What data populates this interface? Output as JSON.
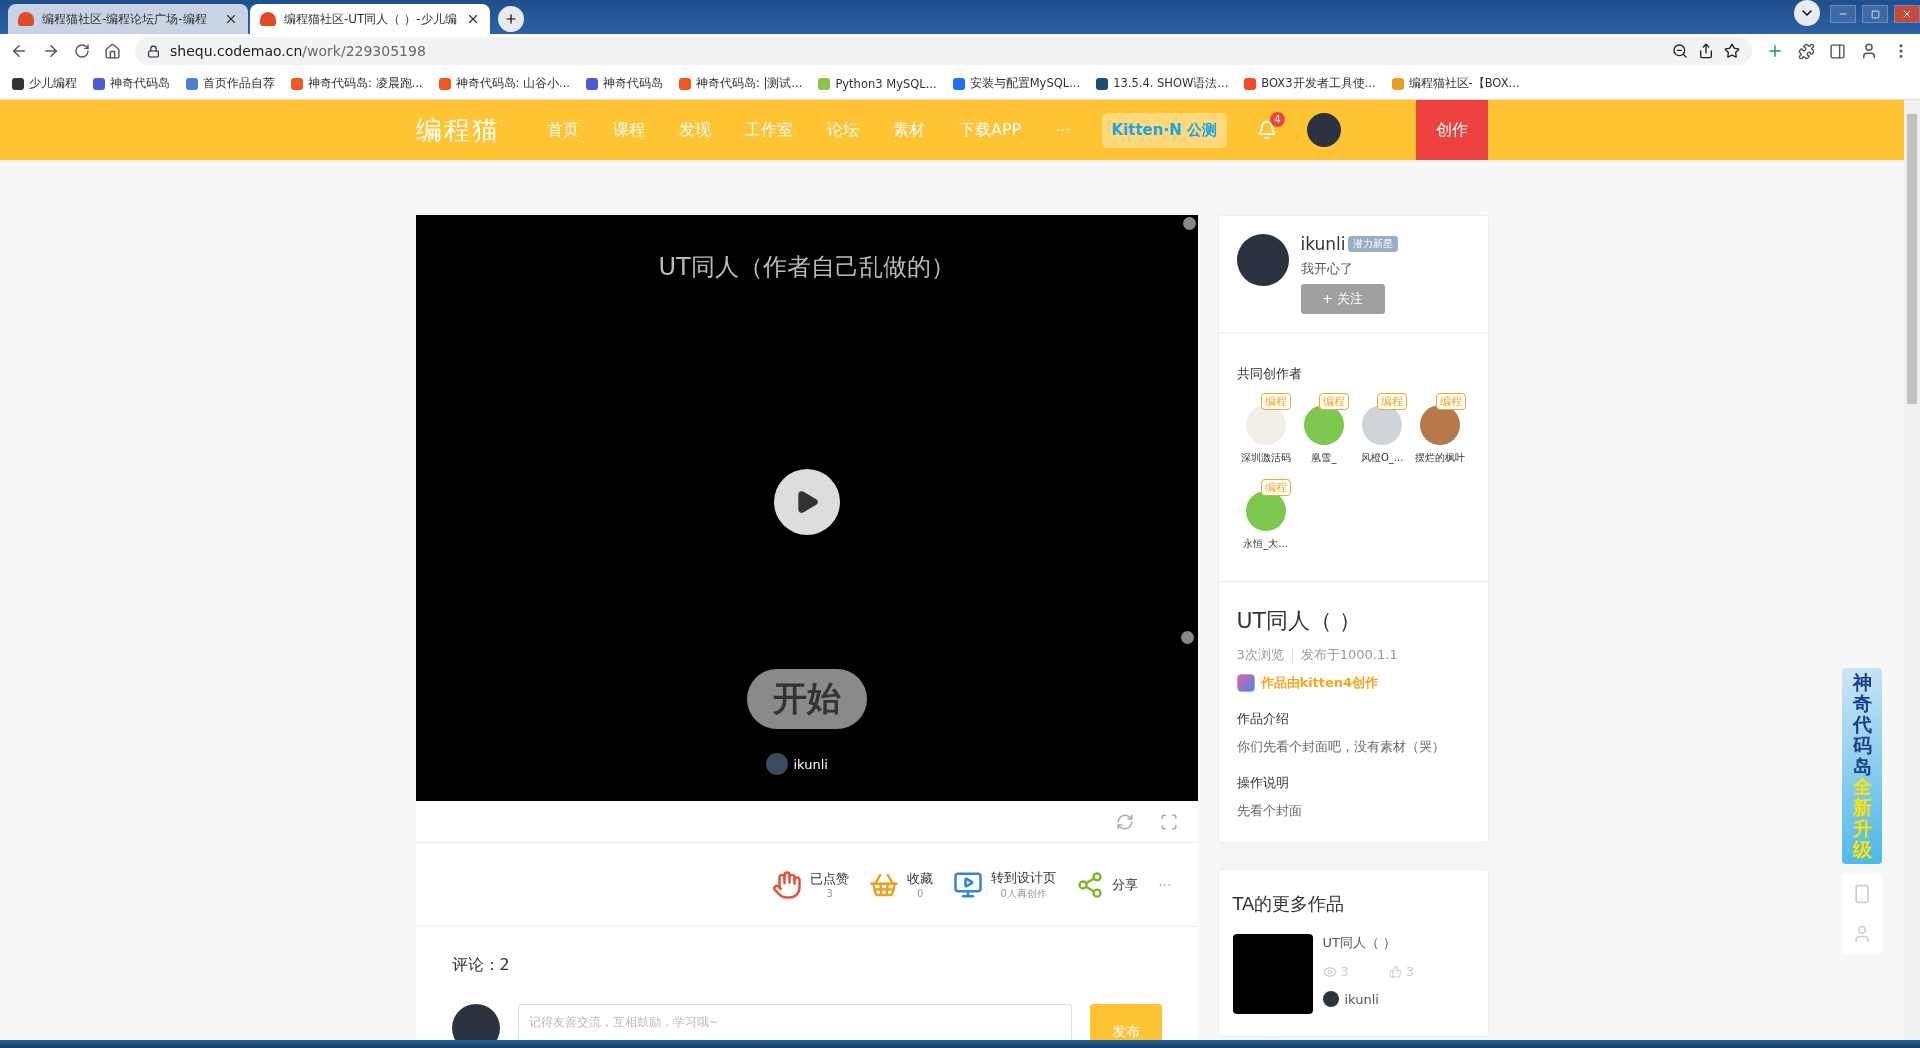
{
  "browser": {
    "tabs": [
      {
        "title": "编程猫社区-编程论坛广场-编程",
        "selected": false
      },
      {
        "title": "编程猫社区-UT同人（ ）-少儿编",
        "selected": true
      }
    ],
    "url_host": "shequ.codemao.cn",
    "url_path": "/work/229305198",
    "bookmarks": [
      {
        "label": "少儿编程",
        "color": "#333333"
      },
      {
        "label": "神奇代码岛",
        "color": "#4a5bd8"
      },
      {
        "label": "首页作品自荐",
        "color": "#4a7fd8"
      },
      {
        "label": "神奇代码岛: 凌晨跑...",
        "color": "#f05a22"
      },
      {
        "label": "神奇代码岛: 山谷小...",
        "color": "#f05a22"
      },
      {
        "label": "神奇代码岛",
        "color": "#4a5bd8"
      },
      {
        "label": "神奇代码岛: |测试...",
        "color": "#f05a22"
      },
      {
        "label": "Python3 MySQL...",
        "color": "#8bc34a"
      },
      {
        "label": "安装与配置MySQL...",
        "color": "#1e6fff"
      },
      {
        "label": "13.5.4. SHOW语法...",
        "color": "#1b4f72"
      },
      {
        "label": "BOX3开发者工具使...",
        "color": "#f04a2a"
      },
      {
        "label": "编程猫社区-【BOX...",
        "color": "#e8a020"
      }
    ]
  },
  "nav": {
    "logo": "编程猫",
    "items": [
      "首页",
      "课程",
      "发现",
      "工作室",
      "论坛",
      "素材",
      "下载APP"
    ],
    "more": "···",
    "kitten_badge": "Kitten·N 公测",
    "notification_count": "4",
    "create": "创作"
  },
  "player": {
    "stage_title": "UT同人（作者自己乱做的）",
    "start": "开始",
    "stage_author": "ikunli"
  },
  "actions": [
    {
      "kind": "like",
      "label": "已点赞",
      "sub": "3"
    },
    {
      "kind": "collect",
      "label": "收藏",
      "sub": "0"
    },
    {
      "kind": "design",
      "label": "转到设计页",
      "sub": "0人再创作"
    },
    {
      "kind": "share",
      "label": "分享"
    }
  ],
  "more_actions": "···",
  "comments": {
    "count": "评论：2",
    "placeholder": "记得友善交流，互相鼓励，学习哦~",
    "submit": "发布"
  },
  "author": {
    "name": "ikunli",
    "badge": "潜力新星",
    "motto": "我开心了",
    "follow": "+ 关注"
  },
  "coauthors": {
    "title": "共同创作者",
    "people": [
      {
        "name": "深圳激活码",
        "tag": "编程",
        "color": "#f3eee8"
      },
      {
        "name": "凰雪_",
        "tag": "编程",
        "color": "#7ec850"
      },
      {
        "name": "风橙O_...",
        "tag": "编程",
        "color": "#cfd4da"
      },
      {
        "name": "摆烂的枫叶",
        "tag": "编程",
        "color": "#b8794a"
      },
      {
        "name": "永恒_大...",
        "tag": "编程",
        "color": "#7ec850"
      }
    ]
  },
  "work": {
    "title": "UT同人（ ）",
    "views": "3次浏览",
    "date": "发布于1000.1.1",
    "creator": "作品由kitten4创作",
    "intro_title": "作品介绍",
    "intro": "你们先看个封面吧，没有素材（哭）",
    "ops_title": "操作说明",
    "ops": "先看个封面"
  },
  "more_works": {
    "title": "TA的更多作品",
    "items": [
      {
        "title": "UT同人（ ）",
        "views": "3",
        "likes": "3",
        "author": "ikunli"
      }
    ]
  },
  "float_banner": {
    "part_1": "神奇代码岛",
    "part_2": "全新升级"
  }
}
